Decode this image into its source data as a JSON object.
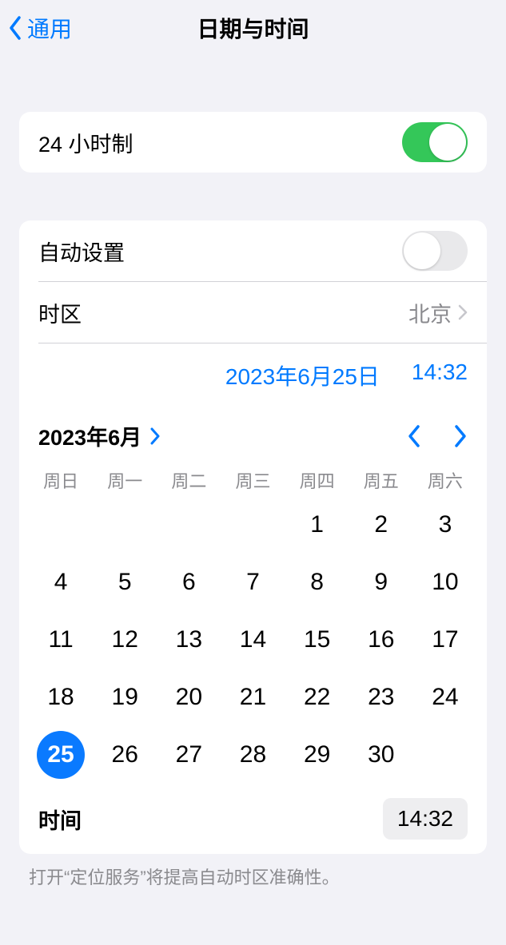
{
  "nav": {
    "back_label": "通用",
    "title": "日期与时间"
  },
  "row24h": {
    "label": "24 小时制",
    "on": true
  },
  "auto_set": {
    "label": "自动设置",
    "on": false
  },
  "timezone": {
    "label": "时区",
    "value": "北京"
  },
  "selected": {
    "date_label": "2023年6月25日",
    "time_label": "14:32"
  },
  "calendar": {
    "month_label": "2023年6月",
    "weekdays": [
      "周日",
      "周一",
      "周二",
      "周三",
      "周四",
      "周五",
      "周六"
    ],
    "leading_blanks": 4,
    "days": [
      1,
      2,
      3,
      4,
      5,
      6,
      7,
      8,
      9,
      10,
      11,
      12,
      13,
      14,
      15,
      16,
      17,
      18,
      19,
      20,
      21,
      22,
      23,
      24,
      25,
      26,
      27,
      28,
      29,
      30
    ],
    "selected_day": 25
  },
  "time_row": {
    "label": "时间",
    "value": "14:32"
  },
  "footer": "打开“定位服务”将提高自动时区准确性。"
}
